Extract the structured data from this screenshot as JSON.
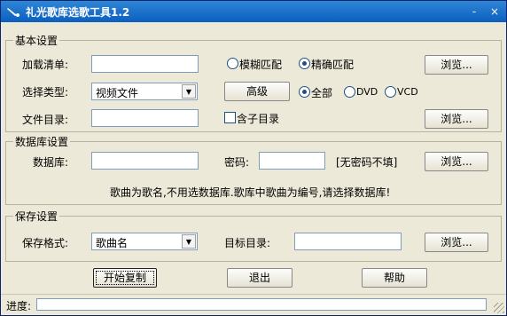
{
  "window": {
    "title": "礼光歌库选歌工具1.2",
    "minimize": "-",
    "close": "×"
  },
  "basic": {
    "group_label": "基本设置",
    "load_list_label": "加载清单:",
    "load_list_value": "",
    "fuzzy_label": "模糊匹配",
    "exact_label": "精确匹配",
    "browse_label": "浏览...",
    "select_type_label": "选择类型:",
    "select_type_value": "视频文件",
    "advanced_label": "高级",
    "all_label": "全部",
    "dvd_label": "DVD",
    "vcd_label": "VCD",
    "file_dir_label": "文件目录:",
    "file_dir_value": "",
    "subdir_label": "含子目录",
    "browse2_label": "浏览..."
  },
  "database": {
    "group_label": "数据库设置",
    "db_label": "数据库:",
    "db_value": "",
    "password_label": "密码:",
    "password_value": "",
    "password_hint": "[无密码不填]",
    "browse_label": "浏览...",
    "note": "歌曲为歌名,不用选数据库.歌库中歌曲为编号,请选择数据库!"
  },
  "save": {
    "group_label": "保存设置",
    "format_label": "保存格式:",
    "format_value": "歌曲名",
    "target_label": "目标目录:",
    "target_value": "",
    "browse_label": "浏览..."
  },
  "actions": {
    "start": "开始复制",
    "exit": "退出",
    "help": "帮助"
  },
  "status": {
    "progress_label": "进度:",
    "progress_fraction": 0
  },
  "colors": {
    "title_bar": "#0b5fc0",
    "window_bg": "#ece9d8"
  }
}
